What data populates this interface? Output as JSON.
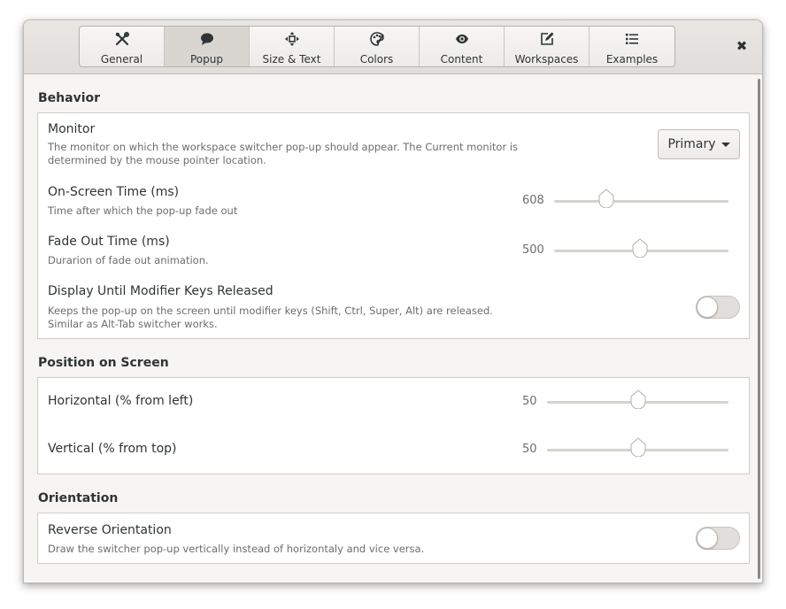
{
  "tabs": [
    {
      "label": "General",
      "icon": "tools-icon"
    },
    {
      "label": "Popup",
      "icon": "speech-bubble-icon",
      "active": true
    },
    {
      "label": "Size & Text",
      "icon": "move-icon"
    },
    {
      "label": "Colors",
      "icon": "palette-icon"
    },
    {
      "label": "Content",
      "icon": "eye-icon"
    },
    {
      "label": "Workspaces",
      "icon": "edit-icon"
    },
    {
      "label": "Examples",
      "icon": "list-icon"
    }
  ],
  "close_glyph": "✖",
  "behavior": {
    "title": "Behavior",
    "monitor": {
      "title": "Monitor",
      "desc_line1": "The monitor on which the workspace switcher pop-up should appear. The Current monitor is",
      "desc_line2": "determined by the mouse pointer location.",
      "value": "Primary"
    },
    "on_screen_time": {
      "title": "On-Screen Time (ms)",
      "desc": "Time after which the pop-up fade out",
      "value": "608",
      "fraction": 0.3
    },
    "fade_out_time": {
      "title": "Fade Out Time (ms)",
      "desc": "Durarion of fade out animation.",
      "value": "500",
      "fraction": 0.49
    },
    "display_until": {
      "title": "Display Until Modifier Keys Released",
      "desc_line1": "Keeps the pop-up on the screen until modifier keys (Shift, Ctrl, Super, Alt) are released.",
      "desc_line2": "Similar as Alt-Tab switcher works.",
      "on": false
    }
  },
  "position": {
    "title": "Position on Screen",
    "horizontal": {
      "title": "Horizontal (% from left)",
      "value": "50",
      "fraction": 0.5
    },
    "vertical": {
      "title": "Vertical (% from top)",
      "value": "50",
      "fraction": 0.5
    }
  },
  "orientation": {
    "title": "Orientation",
    "reverse": {
      "title": "Reverse Orientation",
      "desc": "Draw the switcher pop-up vertically instead of horizontaly and vice versa.",
      "on": false
    }
  }
}
